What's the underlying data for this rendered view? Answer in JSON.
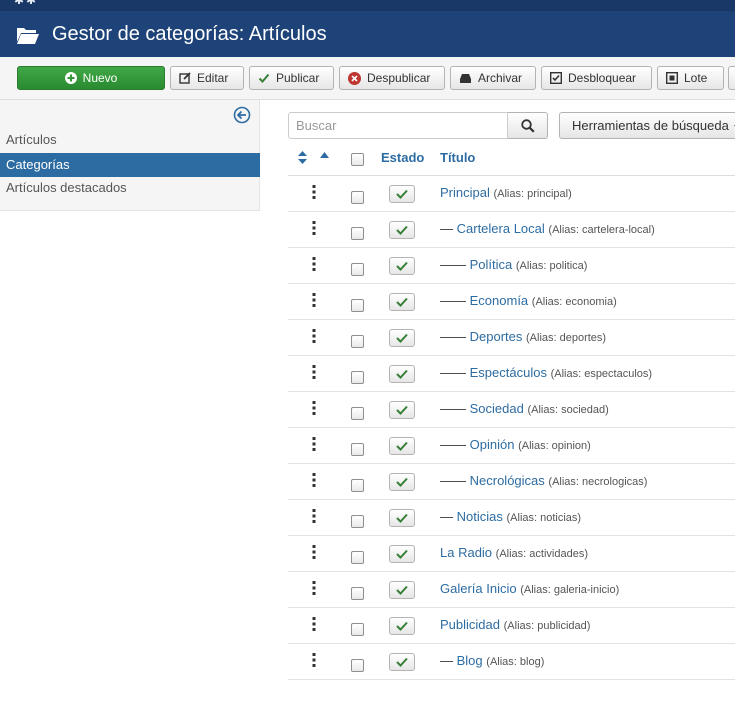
{
  "header": {
    "title": "Gestor de categorías: Artículos"
  },
  "toolbar": {
    "new_label": "Nuevo",
    "edit_label": "Editar",
    "publish_label": "Publicar",
    "unpublish_label": "Despublicar",
    "archive_label": "Archivar",
    "checkin_label": "Desbloquear",
    "batch_label": "Lote"
  },
  "sidebar": {
    "items": [
      {
        "label": "Artículos",
        "active": false
      },
      {
        "label": "Categorías",
        "active": true
      },
      {
        "label": "Artículos destacados",
        "active": false
      }
    ]
  },
  "search": {
    "placeholder": "Buscar",
    "tools_label": "Herramientas de búsqueda"
  },
  "table": {
    "headers": {
      "status": "Estado",
      "title": "Título"
    },
    "rows": [
      {
        "dash": "",
        "title": "Principal",
        "alias": "(Alias: principal)"
      },
      {
        "dash": "— ",
        "title": "Cartelera Local",
        "alias": "(Alias: cartelera-local)"
      },
      {
        "dash": "—— ",
        "title": "Política",
        "alias": "(Alias: politica)"
      },
      {
        "dash": "—— ",
        "title": "Economía",
        "alias": "(Alias: economia)"
      },
      {
        "dash": "—— ",
        "title": "Deportes",
        "alias": "(Alias: deportes)"
      },
      {
        "dash": "—— ",
        "title": "Espectáculos",
        "alias": "(Alias: espectaculos)"
      },
      {
        "dash": "—— ",
        "title": "Sociedad",
        "alias": "(Alias: sociedad)"
      },
      {
        "dash": "—— ",
        "title": "Opinión",
        "alias": "(Alias: opinion)"
      },
      {
        "dash": "—— ",
        "title": "Necrológicas",
        "alias": "(Alias: necrologicas)"
      },
      {
        "dash": "— ",
        "title": "Noticias",
        "alias": "(Alias: noticias)"
      },
      {
        "dash": "",
        "title": "La Radio",
        "alias": "(Alias: actividades)"
      },
      {
        "dash": "",
        "title": "Galería Inicio",
        "alias": "(Alias: galeria-inicio)"
      },
      {
        "dash": "",
        "title": "Publicidad",
        "alias": "(Alias: publicidad)"
      },
      {
        "dash": "— ",
        "title": "Blog",
        "alias": "(Alias: blog)"
      }
    ]
  },
  "colors": {
    "header_bg": "#1d4378",
    "link": "#2d6ca2",
    "new_button": "#2f9a36",
    "published_check": "#378137",
    "unpublish_icon": "#bd362f"
  }
}
